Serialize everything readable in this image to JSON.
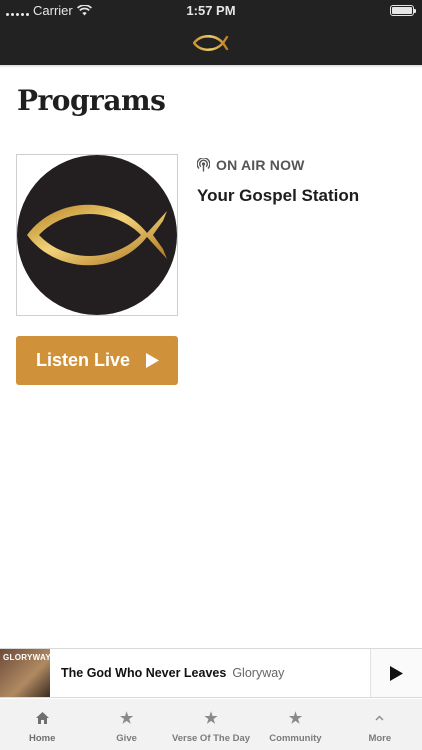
{
  "status_bar": {
    "carrier": "Carrier",
    "time": "1:57 PM"
  },
  "header": {
    "logo_icon": "ichthys-fish-logo-icon"
  },
  "page": {
    "title": "Programs"
  },
  "program": {
    "artwork_icon": "ichthys-fish-circle-artwork",
    "on_air_icon": "broadcast-icon",
    "on_air_label": "ON AIR NOW",
    "station_name": "Your Gospel Station",
    "listen_label": "Listen Live",
    "listen_icon": "play-icon"
  },
  "now_playing": {
    "thumbnail_text": "GLORYWAY",
    "song_title": "The God Who Never Leaves",
    "artist": "Gloryway",
    "play_icon": "play-icon"
  },
  "tabs": [
    {
      "label": "Home",
      "icon": "home-icon"
    },
    {
      "label": "Give",
      "icon": "star-icon"
    },
    {
      "label": "Verse Of The Day",
      "icon": "star-icon"
    },
    {
      "label": "Community",
      "icon": "star-icon"
    },
    {
      "label": "More",
      "icon": "chevron-up-icon"
    }
  ],
  "colors": {
    "accent": "#cf923b",
    "header_bg": "#222222",
    "tabbar_bg": "#f2f2f2"
  }
}
